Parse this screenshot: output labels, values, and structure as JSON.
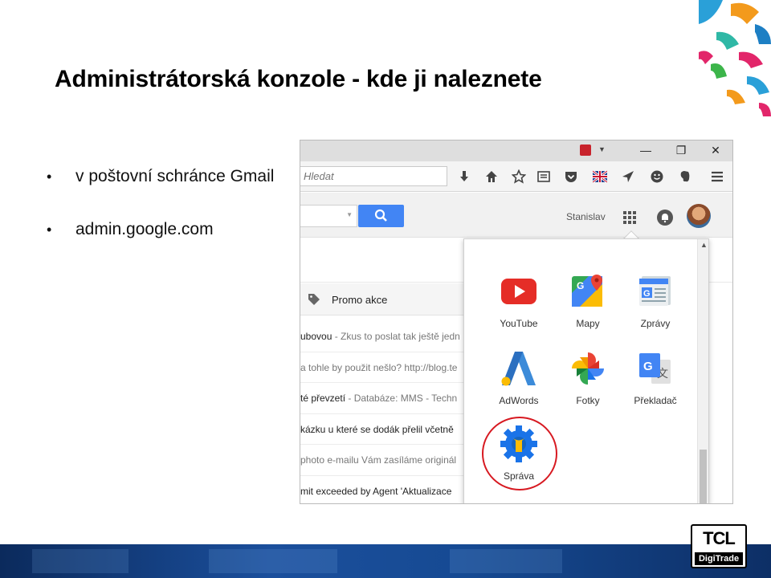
{
  "slide": {
    "title": "Administrátorská konzole - kde ji naleznete",
    "bullets": [
      "v poštovní schránce Gmail",
      "admin.google.com"
    ]
  },
  "browser": {
    "window_controls": [
      "minimize-icon",
      "restore-icon",
      "close-icon"
    ],
    "search_placeholder": "Hledat",
    "toolbar_icons": [
      "download-icon",
      "home-icon",
      "star-icon",
      "reading-list-icon",
      "pocket-icon",
      "uk-flag-icon",
      "send-icon",
      "smiley-icon",
      "evernote-icon",
      "menu-icon"
    ]
  },
  "gmail": {
    "user_name": "Stanislav",
    "promo_label": "Promo akce",
    "mails": [
      {
        "subject": "ubovou",
        "snippet": " - Zkus to poslat tak ještě jedn"
      },
      {
        "subject": "",
        "snippet": "a tohle by použit nešlo? http://blog.te"
      },
      {
        "subject": "té převzetí",
        "snippet": " - Databáze: MMS - Techn"
      },
      {
        "subject": "kázku u které se dodák přelil včetně",
        "snippet": ""
      },
      {
        "subject": "",
        "snippet": "photo e-mailu Vám zasíláme originál"
      },
      {
        "subject": "mit exceeded by Agent 'Aktualizace",
        "snippet": ""
      }
    ]
  },
  "launcher": {
    "apps": [
      {
        "name": "YouTube",
        "icon": "youtube-icon"
      },
      {
        "name": "Mapy",
        "icon": "maps-icon"
      },
      {
        "name": "Zprávy",
        "icon": "news-icon"
      },
      {
        "name": "AdWords",
        "icon": "adwords-icon"
      },
      {
        "name": "Fotky",
        "icon": "photos-icon"
      },
      {
        "name": "Překladač",
        "icon": "translate-icon"
      },
      {
        "name": "Správa",
        "icon": "admin-icon"
      }
    ]
  },
  "logo": {
    "brand": "TCL",
    "sub": "DigiTrade"
  },
  "colors": {
    "accent_blue": "#4285f4",
    "highlight_red": "#d71921",
    "band_blue": "#164a93"
  }
}
